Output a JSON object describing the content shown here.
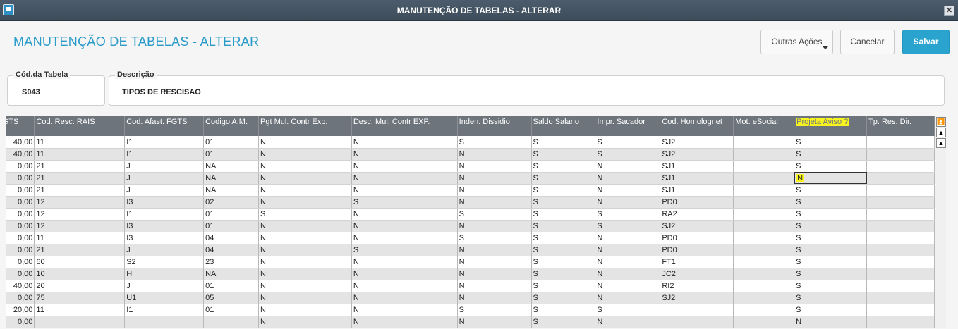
{
  "window": {
    "title": "MANUTENÇÃO DE TABELAS - ALTERAR"
  },
  "header": {
    "title": "MANUTENÇÃO DE TABELAS - ALTERAR",
    "outras_acoes_label": "Outras Ações",
    "cancel_label": "Cancelar",
    "save_label": "Salvar"
  },
  "form": {
    "cod_label": "Cód.da Tabela",
    "cod_value": "S043",
    "desc_label": "Descrição",
    "desc_value": "TIPOS DE RESCISAO"
  },
  "grid": {
    "columns": [
      "FGTS",
      "Cod. Resc. RAIS",
      "Cod. Afast. FGTS",
      "Codigo A.M.",
      "Pgt Mul. Contr Exp.",
      "Desc. Mul. Contr EXP.",
      "Inden. Dissidio",
      "Saldo Salario",
      "Impr. Sacador",
      "Cod. Homolognet",
      "Mot. eSocial",
      "Projeta Aviso ?",
      "Tp. Res. Dir."
    ],
    "rows": [
      [
        "40,00",
        "11",
        "I1",
        "01",
        "N",
        "N",
        "S",
        "S",
        "S",
        "SJ2",
        "",
        "S",
        ""
      ],
      [
        "40,00",
        "11",
        "I1",
        "01",
        "N",
        "N",
        "N",
        "S",
        "S",
        "SJ2",
        "",
        "S",
        ""
      ],
      [
        "0,00",
        "21",
        "J",
        "NA",
        "N",
        "N",
        "N",
        "S",
        "N",
        "SJ1",
        "",
        "S",
        ""
      ],
      [
        "0,00",
        "21",
        "J",
        "NA",
        "N",
        "N",
        "N",
        "S",
        "N",
        "SJ1",
        "",
        "N",
        ""
      ],
      [
        "0,00",
        "21",
        "J",
        "NA",
        "N",
        "N",
        "N",
        "S",
        "N",
        "SJ1",
        "",
        "S",
        ""
      ],
      [
        "0,00",
        "12",
        "I3",
        "02",
        "N",
        "S",
        "N",
        "S",
        "N",
        "PD0",
        "",
        "S",
        ""
      ],
      [
        "0,00",
        "12",
        "I1",
        "01",
        "S",
        "N",
        "S",
        "S",
        "S",
        "RA2",
        "",
        "S",
        ""
      ],
      [
        "0,00",
        "12",
        "I3",
        "01",
        "N",
        "N",
        "N",
        "S",
        "S",
        "SJ2",
        "",
        "S",
        ""
      ],
      [
        "0,00",
        "11",
        "I3",
        "04",
        "N",
        "N",
        "S",
        "S",
        "N",
        "PD0",
        "",
        "S",
        ""
      ],
      [
        "0,00",
        "21",
        "J",
        "04",
        "N",
        "S",
        "N",
        "S",
        "N",
        "PD0",
        "",
        "S",
        ""
      ],
      [
        "0,00",
        "60",
        "S2",
        "23",
        "N",
        "N",
        "N",
        "S",
        "N",
        "FT1",
        "",
        "S",
        ""
      ],
      [
        "0,00",
        "10",
        "H",
        "NA",
        "N",
        "N",
        "N",
        "S",
        "N",
        "JC2",
        "",
        "S",
        ""
      ],
      [
        "40,00",
        "20",
        "J",
        "01",
        "N",
        "N",
        "N",
        "S",
        "N",
        "RI2",
        "",
        "S",
        ""
      ],
      [
        "0,00",
        "75",
        "U1",
        "05",
        "N",
        "N",
        "N",
        "S",
        "N",
        "SJ2",
        "",
        "S",
        ""
      ],
      [
        "20,00",
        "11",
        "I1",
        "01",
        "N",
        "N",
        "S",
        "S",
        "S",
        "",
        "",
        "S",
        ""
      ],
      [
        "0,00",
        "",
        "",
        "",
        "N",
        "N",
        "N",
        "S",
        "N",
        "",
        "",
        "N",
        ""
      ]
    ],
    "highlight_column_index": 11,
    "selected_row_index": 3
  },
  "colors": {
    "accent": "#2a9bc9",
    "header_bg": "#6d747b",
    "highlight": "#f8f420",
    "save_button": "#2aa4cf"
  },
  "icons": {
    "window": "window-icon",
    "close": "close-icon",
    "dropdown": "chevron-down-icon",
    "scroll_top": "scroll-top-icon",
    "scroll_page_up": "scroll-page-up-icon",
    "scroll_up": "scroll-up-icon"
  }
}
